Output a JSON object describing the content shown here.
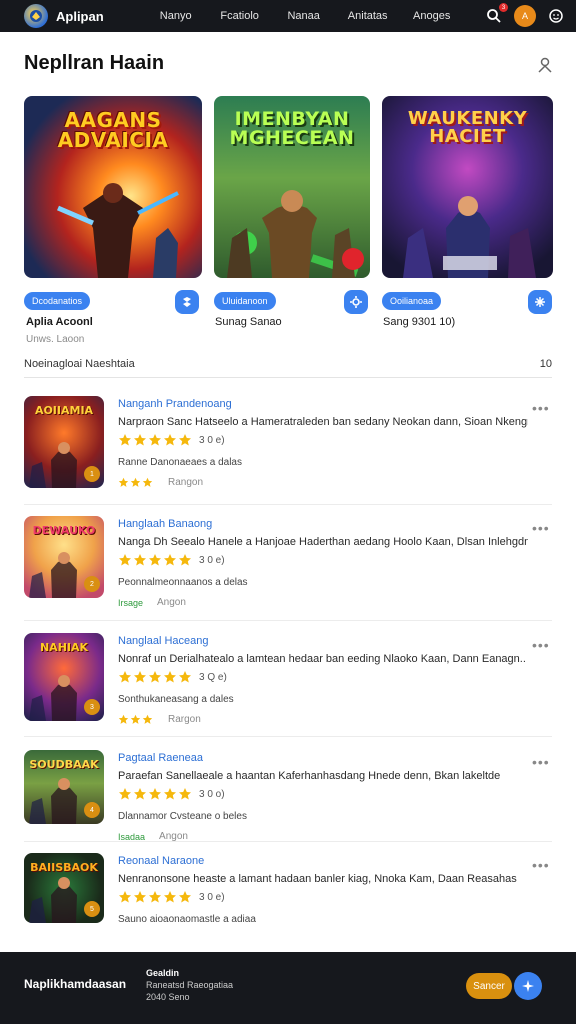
{
  "app": {
    "brand": "Aplipan"
  },
  "nav": {
    "links": [
      "Nanyo",
      "Fcatiolo",
      "Nanaa",
      "Anitatas",
      "Anoges"
    ],
    "notif_count": "3",
    "avatar_initial": "A"
  },
  "header": {
    "title": "Nepllran Haain"
  },
  "featured": [
    {
      "art_title": "AAGANS ADVAICIA",
      "tag": "Dcodanatios",
      "name": "Aplia Acoonl",
      "sub": "Unws. Laoon"
    },
    {
      "art_title": "IMENBYAN MGHECEAN",
      "tag": "Uluidanoon",
      "name": "Sunag Sanao",
      "sub": ""
    },
    {
      "art_title": "WAUKENKY HACIET",
      "tag": "Ooilianoaa",
      "name": "Sang 9301 10)",
      "sub": ""
    }
  ],
  "section": {
    "title": "Noeinagloai Naeshtaia",
    "count": "10"
  },
  "list": [
    {
      "thumb_title": "AOIIAMIA",
      "title": "Nanganh Prandenoang",
      "desc": "Narpraon Sanc Hatseelo a Hameratraleden ban sedany Neokan dann, Sioan Nkengn..",
      "rating": 5,
      "rating_text": "3 0 e)",
      "meta": "Ranne Danonaeaes a dalas",
      "sub_stars": 3,
      "sub_green": "",
      "sub_text": "Rangon",
      "badge": "1"
    },
    {
      "thumb_title": "DEWAUKO",
      "title": "Hanglaah Banaong",
      "desc": "Nanga Dh Seealo Hanele a Hanjoae Haderthan aedang Hoolo Kaan, Dlsan Inlehgdn",
      "rating": 5,
      "rating_text": "3 0 e)",
      "meta": "Peonnalmeonnaanos a delas",
      "sub_stars": 0,
      "sub_green": "Irsage",
      "sub_text": "Angon",
      "badge": "2"
    },
    {
      "thumb_title": "NAHIAK",
      "title": "Nanglaal Haceang",
      "desc": "Nonraf un Derialhatealo a lamtean hedaar ban eeding Nlaoko Kaan, Dann Eanagn..",
      "rating": 5,
      "rating_text": "3 Q e)",
      "meta": "Sonthukaneasang a dales",
      "sub_stars": 3,
      "sub_green": "",
      "sub_text": "Rargon",
      "badge": "3"
    },
    {
      "thumb_title": "SOUDBAAK",
      "title": "Pagtaal Raeneaa",
      "desc": "Paraefan Sanellaeale a haantan Kaferhanhasdang Hnede denn, Bkan lakeltde",
      "rating": 5,
      "rating_text": "3 0 o)",
      "meta": "Dlannamor Cvsteane o beles",
      "sub_stars": 0,
      "sub_green": "Isadaa",
      "sub_text": "Angon",
      "badge": "4"
    },
    {
      "thumb_title": "BAIISBAOK",
      "title": "Reonaal Naraone",
      "desc": "Nenranonsone heaste a lamant hadaan banler kiag, Nnoka Kam, Daan Reasahas",
      "rating": 5,
      "rating_text": "3 0 e)",
      "meta": "Sauno aioaonaomastle a adiaa",
      "sub_stars": 0,
      "sub_green": "",
      "sub_text": "",
      "badge": "5"
    }
  ],
  "footer": {
    "brand": "Naplikhamdaasan",
    "info_title": "Gealdin",
    "info_line1": "Raneatsd Raeogatiaa",
    "info_line2": "2040 Seno",
    "button": "Sancer"
  },
  "colors": {
    "nav_bg": "#16181d",
    "accent": "#3b82f0",
    "orange": "#d9900f",
    "link": "#2d6fd4",
    "star": "#f5b80d"
  }
}
